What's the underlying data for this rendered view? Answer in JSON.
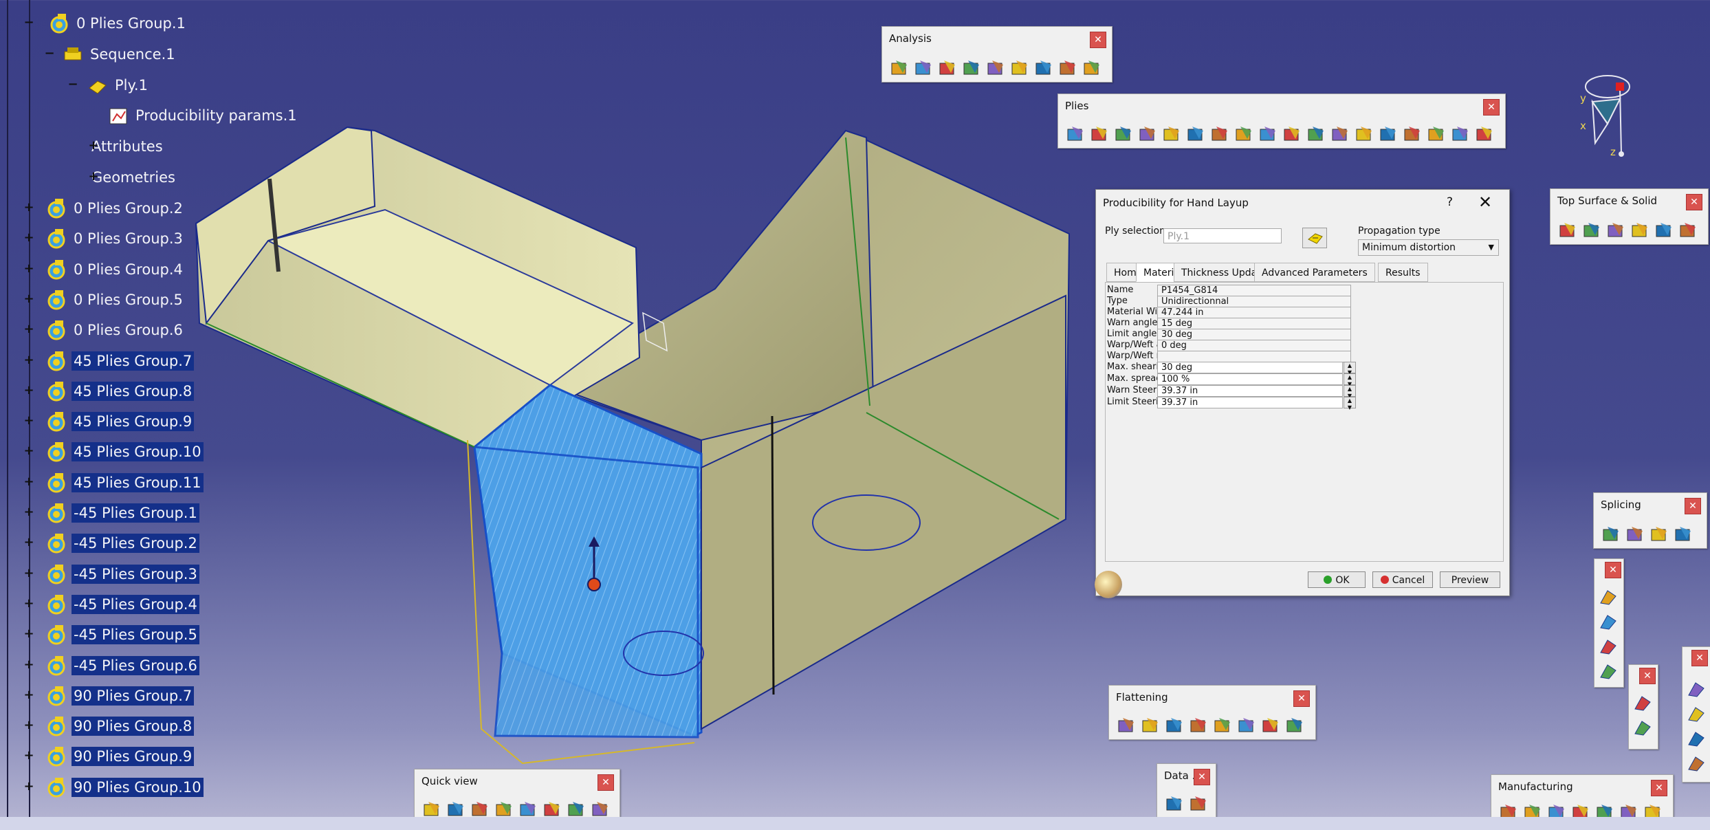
{
  "tree": {
    "items": [
      {
        "label": "0 Plies Group.1"
      },
      {
        "label": "Sequence.1"
      },
      {
        "label": "Ply.1"
      },
      {
        "label": "Producibility params.1"
      },
      {
        "label": "Attributes"
      },
      {
        "label": "Geometries"
      },
      {
        "label": "0 Plies Group.2"
      },
      {
        "label": "0 Plies Group.3"
      },
      {
        "label": "0 Plies Group.4"
      },
      {
        "label": "0 Plies Group.5"
      },
      {
        "label": "0 Plies Group.6"
      },
      {
        "label": "45 Plies Group.7"
      },
      {
        "label": "45 Plies Group.8"
      },
      {
        "label": "45 Plies Group.9"
      },
      {
        "label": "45 Plies Group.10"
      },
      {
        "label": "45 Plies Group.11"
      },
      {
        "label": "-45 Plies Group.1"
      },
      {
        "label": "-45 Plies Group.2"
      },
      {
        "label": "-45 Plies Group.3"
      },
      {
        "label": "-45 Plies Group.4"
      },
      {
        "label": "-45 Plies Group.5"
      },
      {
        "label": "-45 Plies Group.6"
      },
      {
        "label": "90 Plies Group.7"
      },
      {
        "label": "90 Plies Group.8"
      },
      {
        "label": "90 Plies Group.9"
      },
      {
        "label": "90 Plies Group.10"
      }
    ]
  },
  "toolbars": {
    "analysis": {
      "title": "Analysis"
    },
    "plies": {
      "title": "Plies"
    },
    "top_surface": {
      "title": "Top Surface & Solid"
    },
    "splicing": {
      "title": "Splicing"
    },
    "flattening": {
      "title": "Flattening"
    },
    "quick_view": {
      "title": "Quick view"
    },
    "data": {
      "title": "Data ..."
    },
    "manufacturing": {
      "title": "Manufacturing"
    },
    "close_glyph": "✕"
  },
  "compass": {
    "y": "y",
    "x": "x",
    "z": "z"
  },
  "dialog": {
    "title": "Producibility for Hand Layup",
    "help": "?",
    "close": "✕",
    "ply_selection_label": "Ply selection",
    "ply_selection_value": "Ply.1",
    "propagation_label": "Propagation type",
    "propagation_value": "Minimum distortion",
    "tabs": [
      "Home",
      "Material",
      "Thickness Update",
      "Advanced Parameters",
      "Results"
    ],
    "active_tab": "Material",
    "rows": [
      {
        "label": "Name",
        "value": "P1454_G814"
      },
      {
        "label": "Type",
        "value": "Unidirectionnal"
      },
      {
        "label": "Material Width",
        "value": "47.244 in"
      },
      {
        "label": "Warn angle",
        "value": "15 deg"
      },
      {
        "label": "Limit angle",
        "value": "30 deg"
      },
      {
        "label": "Warp/Weft angle",
        "value": "0 deg"
      },
      {
        "label": "Warp/Weft ratio",
        "value": ""
      },
      {
        "label": "Max. shearing",
        "value": "30 deg"
      },
      {
        "label": "Max. spreading",
        "value": "100 %"
      },
      {
        "label": "Warn Steering",
        "value": "39.37 in"
      },
      {
        "label": "Limit Steering",
        "value": "39.37 in"
      }
    ],
    "ok": "OK",
    "cancel": "Cancel",
    "preview": "Preview"
  },
  "colors": {
    "background": "#3f4389",
    "part_surface": "#d8d6a6",
    "selected_ply": "#4a9ee8",
    "close_button": "#d9534f"
  }
}
